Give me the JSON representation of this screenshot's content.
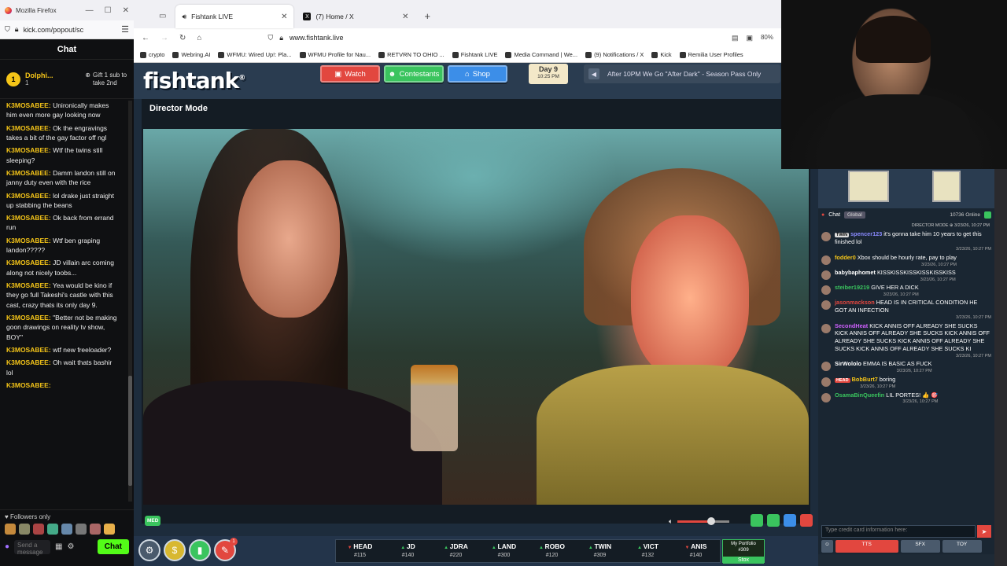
{
  "kick": {
    "window_title": "Mozilla Firefox",
    "url": "kick.com/popout/sc",
    "chat_header": "Chat",
    "pinned": {
      "badge": "1",
      "name": "Dolphi...",
      "count": "1",
      "gift_label": "Gift 1 sub to take 2nd"
    },
    "messages": [
      {
        "user": "K3MOSABEE:",
        "text": "Unironically makes him even more gay looking now"
      },
      {
        "user": "K3MOSABEE:",
        "text": "Ok the engravings takes a bit of the gay factor off ngl"
      },
      {
        "user": "K3MOSABEE:",
        "text": "Wtf the twins still sleeping?"
      },
      {
        "user": "K3MOSABEE:",
        "text": "Damm landon still on janny duty even with the rice"
      },
      {
        "user": "K3MOSABEE:",
        "text": "lol drake just straight up stabbing the beans"
      },
      {
        "user": "K3MOSABEE:",
        "text": "Ok back from errand run"
      },
      {
        "user": "K3MOSABEE:",
        "text": "Wtf ben graping landon?????"
      },
      {
        "user": "K3MOSABEE:",
        "text": "JD villain arc coming along not nicely toobs..."
      },
      {
        "user": "K3MOSABEE:",
        "text": "Yea would be kino if they go full Takeshi's castle with this cast, crazy thats its only day 9."
      },
      {
        "user": "K3MOSABEE:",
        "text": "\"Better not be making goon drawings on reality tv show, BOY\""
      },
      {
        "user": "K3MOSABEE:",
        "text": "wtf new freeloader?"
      },
      {
        "user": "K3MOSABEE:",
        "text": "Oh wait thats bashir lol"
      },
      {
        "user": "K3MOSABEE:",
        "text": ""
      }
    ],
    "followers_only": "Followers only",
    "input_placeholder": "Send a message",
    "chat_button": "Chat"
  },
  "firefox": {
    "tabs": [
      {
        "label": "Fishtank LIVE",
        "active": true
      },
      {
        "label": "(7) Home / X",
        "active": false
      }
    ],
    "url": "www.fishtank.live",
    "zoom": "80%",
    "bookmarks": [
      "crypto",
      "Webring.AI",
      "WFMU: Wired Up!: Pla...",
      "WFMU Profile for Nau...",
      "RETVRN TO OHIO ...",
      "Fishtank LIVE",
      "Media Command | We...",
      "(9) Notifications / X",
      "Kick",
      "Remilia User Profiles"
    ]
  },
  "fishtank": {
    "logo": "fishtank",
    "nav": {
      "watch": "Watch",
      "contestants": "Contestants",
      "shop": "Shop"
    },
    "day": {
      "label": "Day 9",
      "time": "10:25 PM"
    },
    "banner": "After 10PM We Go \"After Dark\" - Season Pass Only",
    "player_title": "Director Mode",
    "quality": "MED",
    "cams": [
      {
        "name": "HEAD",
        "dir": "down",
        "value": "#115"
      },
      {
        "name": "JD",
        "dir": "up",
        "value": "#140"
      },
      {
        "name": "JDRA",
        "dir": "up",
        "value": "#220"
      },
      {
        "name": "LAND",
        "dir": "up",
        "value": "#300"
      },
      {
        "name": "ROBO",
        "dir": "up",
        "value": "#120"
      },
      {
        "name": "TWIN",
        "dir": "up",
        "value": "#309"
      },
      {
        "name": "VICT",
        "dir": "up",
        "value": "#132"
      },
      {
        "name": "ANIS",
        "dir": "down",
        "value": "#140"
      }
    ],
    "portfolio": {
      "label": "My Portfolio",
      "value": "#309",
      "button": "Stox"
    },
    "notif_count": "1"
  },
  "chat": {
    "title": "Chat",
    "global": "Global",
    "online": "10736 Online",
    "director_line": "DIRECTOR MODE ⊕ 3/23/26, 10:27 PM",
    "messages": [
      {
        "tag": "TWIN",
        "user": "spencer123",
        "ucolor": "#8a8aff",
        "text": "it's gonna take him 10 years to get this finished lol",
        "ts": "3/23/26, 10:27 PM"
      },
      {
        "tag": "",
        "user": "fodder0",
        "ucolor": "#f5c518",
        "text": "Xbox should be hourly rate, pay to play",
        "ts": "3/23/26, 10:27 PM"
      },
      {
        "tag": "",
        "user": "babybaphomet",
        "ucolor": "#ffffff",
        "text": "KISSKISSKISSKISSKISSKISS",
        "ts": "3/23/26, 10:27 PM"
      },
      {
        "tag": "",
        "user": "steiber19219",
        "ucolor": "#3ac45e",
        "text": "GIVE HER A DICK",
        "ts": "3/23/26, 10:27 PM"
      },
      {
        "tag": "",
        "user": "jasonmackson",
        "ucolor": "#e2473f",
        "text": "HEAD IS IN CRITICAL CONDITION HE GOT AN INFECTION",
        "ts": "3/23/26, 10:27 PM"
      },
      {
        "tag": "",
        "user": "SecondHeat",
        "ucolor": "#d060ff",
        "text": "KICK ANNIS OFF ALREADY SHE SUCKS KICK ANNIS OFF ALREADY SHE SUCKS KICK ANNIS OFF ALREADY SHE SUCKS KICK ANNIS OFF ALREADY SHE SUCKS KICK ANNIS OFF ALREADY SHE SUCKS KI",
        "ts": "3/23/26, 10:27 PM"
      },
      {
        "tag": "",
        "user": "SirWololo",
        "ucolor": "#ffffff",
        "text": "EMMA IS BASIC AS FUCK",
        "ts": "3/23/26, 10:27 PM"
      },
      {
        "tag": "HEAD",
        "user": "BobBurt7",
        "ucolor": "#f5c518",
        "text": "boring",
        "ts": "3/23/26, 10:27 PM"
      },
      {
        "tag": "",
        "user": "OsamaBinQueefin",
        "ucolor": "#3ac45e",
        "text": "LIL PORTES! 👍 🎯",
        "ts": "3/23/26, 10:27 PM"
      }
    ],
    "input_placeholder": "Type credit card information here:",
    "bottom": {
      "tts": "TTS",
      "sfx": "SFX",
      "toy": "TOY"
    }
  },
  "colors": {
    "watch": "#e2473f",
    "contestants": "#3ac45e",
    "shop": "#3c8ee8",
    "kick_green": "#53fc18"
  }
}
